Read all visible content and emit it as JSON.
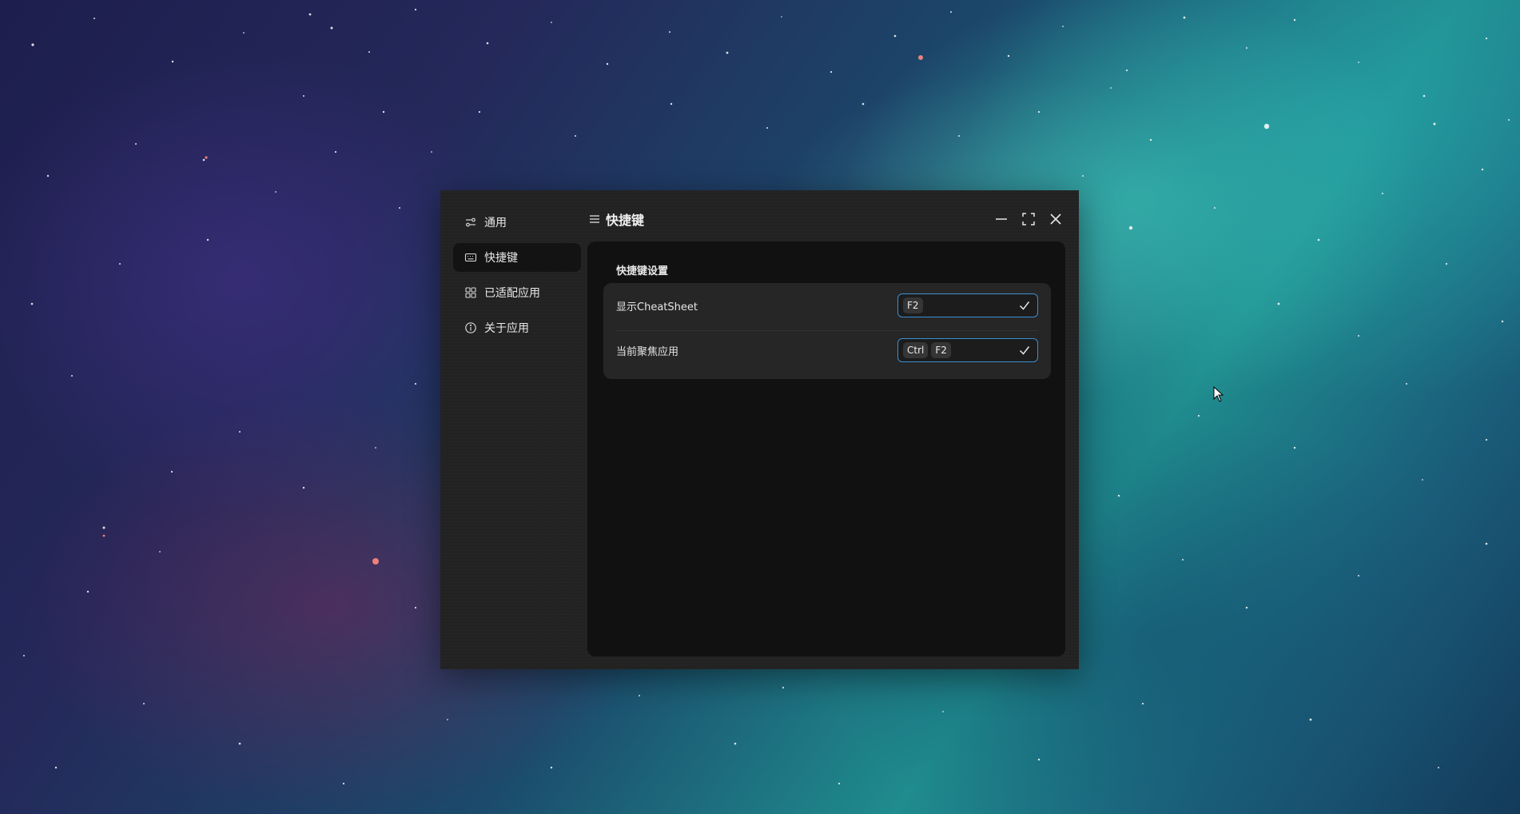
{
  "sidebar": {
    "items": [
      {
        "label": "通用",
        "icon": "sliders-icon"
      },
      {
        "label": "快捷键",
        "icon": "keyboard-icon",
        "active": true
      },
      {
        "label": "已适配应用",
        "icon": "grid-icon"
      },
      {
        "label": "关于应用",
        "icon": "info-icon"
      }
    ]
  },
  "header": {
    "title": "快捷键",
    "menu_icon": "menu-icon",
    "controls": [
      "minimize-icon",
      "maximize-icon",
      "close-icon"
    ]
  },
  "main": {
    "section_title": "快捷键设置",
    "settings": [
      {
        "label": "显示CheatSheet",
        "keys": [
          "F2"
        ],
        "confirm_icon": "check-icon"
      },
      {
        "label": "当前聚焦应用",
        "keys": [
          "Ctrl",
          "F2"
        ],
        "confirm_icon": "check-icon"
      }
    ]
  },
  "colors": {
    "window_bg": "#222222",
    "content_bg": "#111111",
    "card_bg": "#262626",
    "input_border": "#3b8fd0",
    "active_nav_bg": "#131313"
  }
}
